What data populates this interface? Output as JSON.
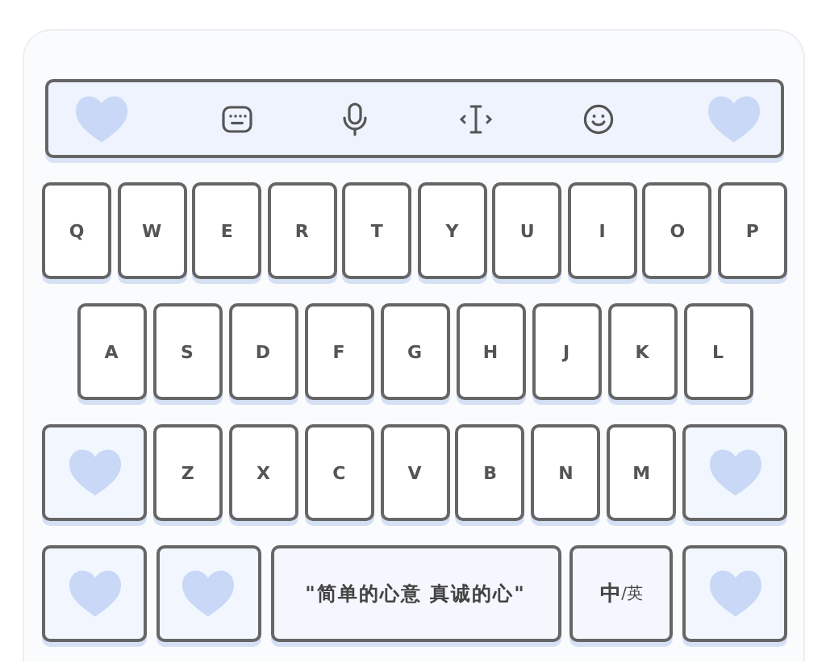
{
  "toolbar": [
    {
      "kind": "heart"
    },
    {
      "kind": "keyboard"
    },
    {
      "kind": "mic"
    },
    {
      "kind": "cursor"
    },
    {
      "kind": "emoji"
    },
    {
      "kind": "heart"
    }
  ],
  "rows": [
    [
      {
        "kind": "letter",
        "label": "Q"
      },
      {
        "kind": "letter",
        "label": "W"
      },
      {
        "kind": "letter",
        "label": "E"
      },
      {
        "kind": "letter",
        "label": "R"
      },
      {
        "kind": "letter",
        "label": "T"
      },
      {
        "kind": "letter",
        "label": "Y"
      },
      {
        "kind": "letter",
        "label": "U"
      },
      {
        "kind": "letter",
        "label": "I"
      },
      {
        "kind": "letter",
        "label": "O"
      },
      {
        "kind": "letter",
        "label": "P"
      }
    ],
    [
      {
        "kind": "letter",
        "label": "A"
      },
      {
        "kind": "letter",
        "label": "S"
      },
      {
        "kind": "letter",
        "label": "D"
      },
      {
        "kind": "letter",
        "label": "F"
      },
      {
        "kind": "letter",
        "label": "G"
      },
      {
        "kind": "letter",
        "label": "H"
      },
      {
        "kind": "letter",
        "label": "J"
      },
      {
        "kind": "letter",
        "label": "K"
      },
      {
        "kind": "letter",
        "label": "L"
      }
    ],
    [
      {
        "kind": "heart"
      },
      {
        "kind": "letter",
        "label": "Z"
      },
      {
        "kind": "letter",
        "label": "X"
      },
      {
        "kind": "letter",
        "label": "C"
      },
      {
        "kind": "letter",
        "label": "V"
      },
      {
        "kind": "letter",
        "label": "B"
      },
      {
        "kind": "letter",
        "label": "N"
      },
      {
        "kind": "letter",
        "label": "M"
      },
      {
        "kind": "heart"
      }
    ],
    [
      {
        "kind": "heart"
      },
      {
        "kind": "heart"
      },
      {
        "kind": "phrase",
        "label": "\"简单的心意 真诚的心\""
      },
      {
        "kind": "lang",
        "label": "**中**/英"
      },
      {
        "kind": "heart"
      }
    ]
  ]
}
